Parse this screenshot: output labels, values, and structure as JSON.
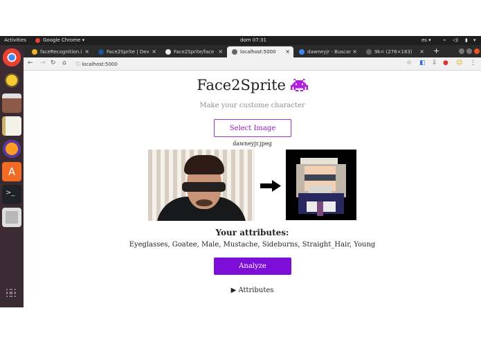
{
  "system": {
    "activities": "Activities",
    "app_menu": "Google Chrome ▾",
    "clock": "dom 07:31",
    "locale": "es ▾"
  },
  "tabs": [
    {
      "title": "faceRecognition.i",
      "favicon_color": "#f0b324"
    },
    {
      "title": "Face2Sprite | Dev",
      "favicon_color": "#1e4f9a"
    },
    {
      "title": "Face2Sprite/face",
      "favicon_color": "#eeeeee"
    },
    {
      "title": "localhost:5000",
      "favicon_color": "#666666"
    },
    {
      "title": "dawneyjr - Buscar",
      "favicon_color": "#4285f4"
    },
    {
      "title": "9k= (276×183)",
      "favicon_color": "#666666"
    }
  ],
  "address": {
    "url": "localhost:5000"
  },
  "app": {
    "title": "Face2Sprite",
    "subtitle": "Make your custome character",
    "select_label": "Select Image",
    "filename": "dawneyjr.jpeg",
    "attributes_heading": "Your attributes:",
    "attributes": "Eyeglasses, Goatee, Male, Mustache, Sideburns, Straight_Hair, Young",
    "analyze_label": "Analyze",
    "details_label": "▶ Attributes"
  },
  "colors": {
    "accent": "#7c0ed8",
    "outline": "#9b32cc",
    "dock": "#3a2b33"
  }
}
